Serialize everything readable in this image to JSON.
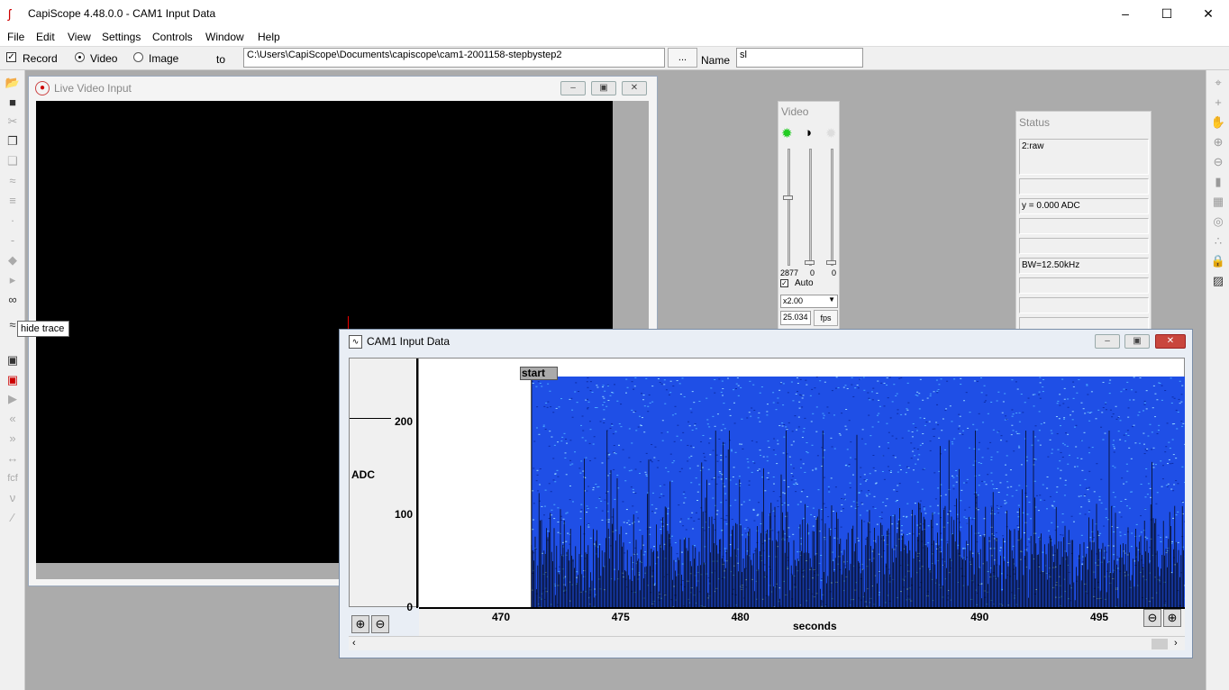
{
  "app": {
    "title": "CapiScope 4.48.0.0 - CAM1 Input Data"
  },
  "menu": [
    "File",
    "Edit",
    "View",
    "Settings",
    "Controls",
    "Window",
    "Help"
  ],
  "toolbar": {
    "record_label": "Record",
    "video_label": "Video",
    "image_label": "Image",
    "to_label": "to",
    "path_value": "C:\\Users\\CapiScope\\Documents\\capiscope\\cam1-2001158-stepbystep2",
    "browse_label": "...",
    "name_label": "Name",
    "name_value": "sl"
  },
  "tooltip": "hide trace",
  "live_video": {
    "title": "Live Video Input"
  },
  "video_panel": {
    "title": "Video",
    "slider_values": [
      "2877",
      "0",
      "0"
    ],
    "auto_label": "Auto",
    "zoom_value": "x2.00",
    "fps_value": "25.034",
    "fps_label": "fps"
  },
  "status_panel": {
    "title": "Status",
    "rows": [
      "2:raw",
      "",
      "y = 0.000 ADC",
      "",
      "",
      "BW=12.50kHz",
      "",
      "",
      ""
    ]
  },
  "cam_window": {
    "title": "CAM1 Input Data",
    "start_label": "start",
    "chart_data": {
      "type": "line",
      "ylabel": "ADC",
      "xlabel": "seconds",
      "y_ticks": [
        "200",
        "100",
        "0"
      ],
      "x_ticks": [
        "470",
        "475",
        "480",
        "490",
        "495"
      ],
      "ylim": [
        0,
        250
      ],
      "xlim": [
        466.5,
        498.5
      ],
      "start_x": 471.2,
      "colors": {
        "fill": "#1f4fe6",
        "trace": "#000000"
      }
    }
  }
}
